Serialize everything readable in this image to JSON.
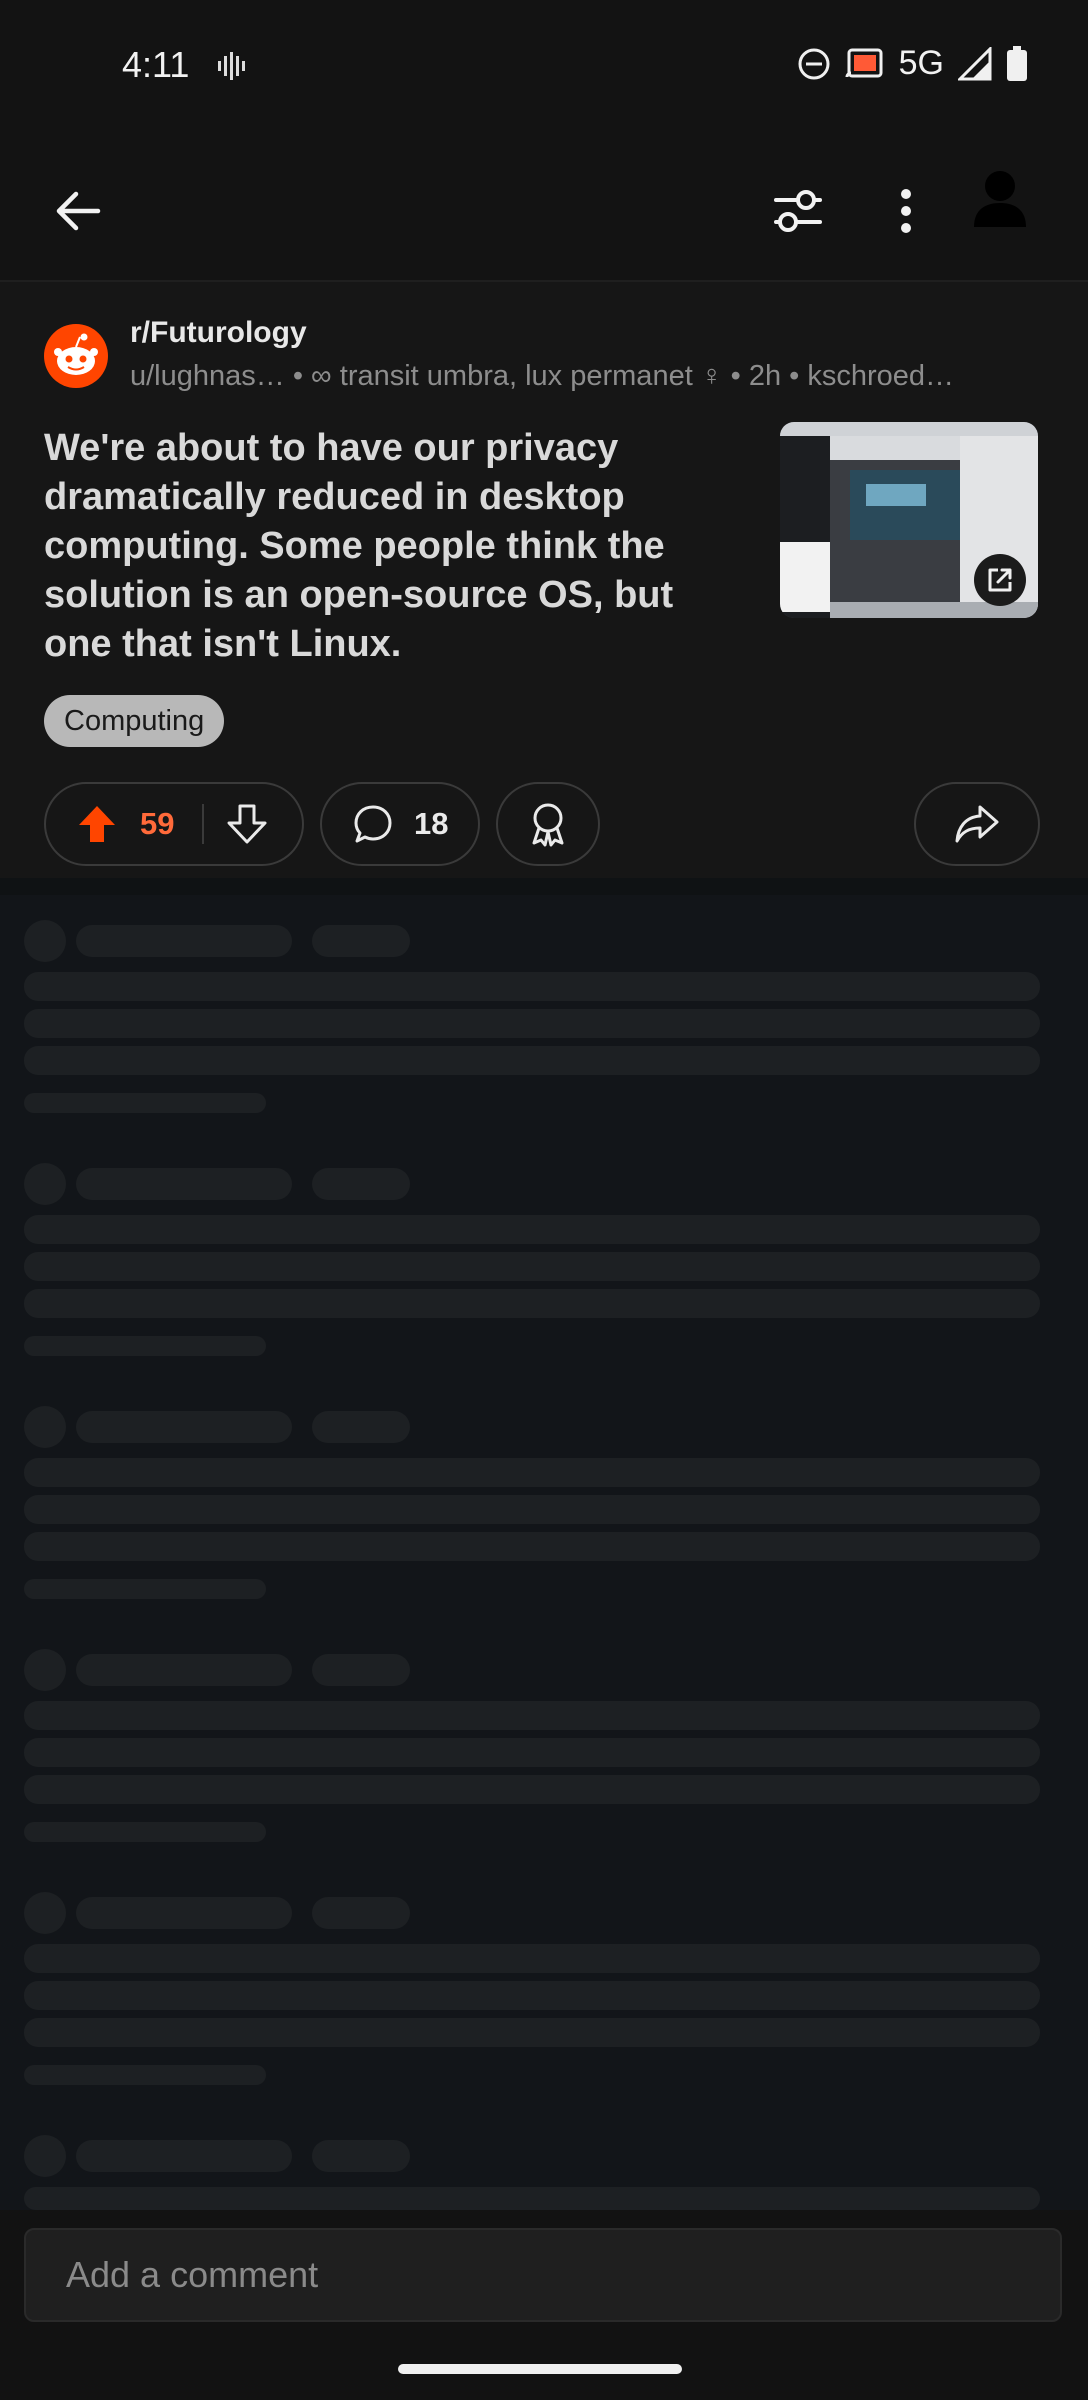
{
  "status_bar": {
    "time": "4:11",
    "network": "5G"
  },
  "app_bar": {
    "icons": [
      "back-arrow-icon",
      "filter-icon",
      "more-vert-icon",
      "profile-icon"
    ]
  },
  "post": {
    "subreddit": "r/Futurology",
    "meta": "u/lughnas… • ∞ transit umbra, lux permanet ♀ • 2h • kschroed…",
    "title": "We're about to have our privacy dramatically reduced in desktop computing. Some people think the solution is an open-source OS, but one that isn't Linux.",
    "flair": "Computing",
    "upvotes": "59",
    "comments": "18"
  },
  "comment_box": {
    "placeholder": "Add a comment"
  },
  "colors": {
    "upvote": "#ff4500",
    "background": "#0f1214",
    "post_background": "#161616"
  }
}
